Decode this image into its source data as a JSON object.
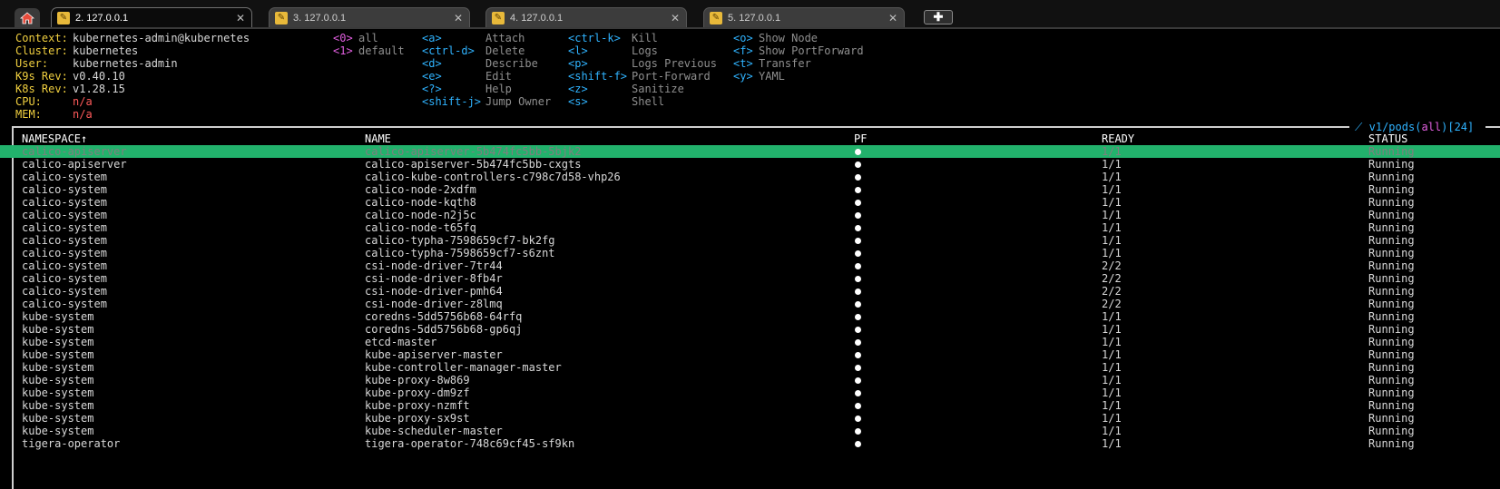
{
  "tabs": {
    "home_icon": "home-icon",
    "items": [
      {
        "label": "2. 127.0.0.1",
        "active": true
      },
      {
        "label": "3. 127.0.0.1",
        "active": false
      },
      {
        "label": "4. 127.0.0.1",
        "active": false
      },
      {
        "label": "5. 127.0.0.1",
        "active": false
      }
    ],
    "new_tab_symbol": "✚"
  },
  "info": {
    "context_label": "Context:",
    "context_value": "kubernetes-admin@kubernetes",
    "cluster_label": "Cluster:",
    "cluster_value": "kubernetes",
    "user_label": "User:",
    "user_value": "kubernetes-admin",
    "k9s_label": "K9s Rev:",
    "k9s_value": "v0.40.10",
    "k8s_label": "K8s Rev:",
    "k8s_value": "v1.28.15",
    "cpu_label": "CPU:",
    "cpu_value": "n/a",
    "mem_label": "MEM:",
    "mem_value": "n/a"
  },
  "namespaces": [
    {
      "key": "<0>",
      "label": "all"
    },
    {
      "key": "<1>",
      "label": "default"
    }
  ],
  "shortcuts": {
    "col1": [
      {
        "key": "<a>",
        "label": "Attach"
      },
      {
        "key": "<ctrl-d>",
        "label": "Delete"
      },
      {
        "key": "<d>",
        "label": "Describe"
      },
      {
        "key": "<e>",
        "label": "Edit"
      },
      {
        "key": "<?>",
        "label": "Help"
      },
      {
        "key": "<shift-j>",
        "label": "Jump Owner"
      }
    ],
    "col2": [
      {
        "key": "<ctrl-k>",
        "label": "Kill"
      },
      {
        "key": "<l>",
        "label": "Logs"
      },
      {
        "key": "<p>",
        "label": "Logs Previous"
      },
      {
        "key": "<shift-f>",
        "label": "Port-Forward"
      },
      {
        "key": "<z>",
        "label": "Sanitize"
      },
      {
        "key": "<s>",
        "label": "Shell"
      }
    ],
    "col3": [
      {
        "key": "<o>",
        "label": "Show Node"
      },
      {
        "key": "<f>",
        "label": "Show PortForward"
      },
      {
        "key": "<t>",
        "label": "Transfer"
      },
      {
        "key": "<y>",
        "label": "YAML"
      }
    ]
  },
  "view_title": {
    "prefix": " v1/pods(",
    "scope": "all",
    "suffix": ")[24] "
  },
  "table": {
    "headers": {
      "namespace": "NAMESPACE↑",
      "name": "NAME",
      "pf": "PF",
      "ready": "READY",
      "status": "STATUS"
    },
    "selected_index": 0,
    "rows": [
      {
        "namespace": "calico-apiserver",
        "name": "calico-apiserver-5b474fc5bb-5bjk2",
        "ready": "1/1",
        "status": "Running"
      },
      {
        "namespace": "calico-apiserver",
        "name": "calico-apiserver-5b474fc5bb-cxgts",
        "ready": "1/1",
        "status": "Running"
      },
      {
        "namespace": "calico-system",
        "name": "calico-kube-controllers-c798c7d58-vhp26",
        "ready": "1/1",
        "status": "Running"
      },
      {
        "namespace": "calico-system",
        "name": "calico-node-2xdfm",
        "ready": "1/1",
        "status": "Running"
      },
      {
        "namespace": "calico-system",
        "name": "calico-node-kqth8",
        "ready": "1/1",
        "status": "Running"
      },
      {
        "namespace": "calico-system",
        "name": "calico-node-n2j5c",
        "ready": "1/1",
        "status": "Running"
      },
      {
        "namespace": "calico-system",
        "name": "calico-node-t65fq",
        "ready": "1/1",
        "status": "Running"
      },
      {
        "namespace": "calico-system",
        "name": "calico-typha-7598659cf7-bk2fg",
        "ready": "1/1",
        "status": "Running"
      },
      {
        "namespace": "calico-system",
        "name": "calico-typha-7598659cf7-s6znt",
        "ready": "1/1",
        "status": "Running"
      },
      {
        "namespace": "calico-system",
        "name": "csi-node-driver-7tr44",
        "ready": "2/2",
        "status": "Running"
      },
      {
        "namespace": "calico-system",
        "name": "csi-node-driver-8fb4r",
        "ready": "2/2",
        "status": "Running"
      },
      {
        "namespace": "calico-system",
        "name": "csi-node-driver-pmh64",
        "ready": "2/2",
        "status": "Running"
      },
      {
        "namespace": "calico-system",
        "name": "csi-node-driver-z8lmq",
        "ready": "2/2",
        "status": "Running"
      },
      {
        "namespace": "kube-system",
        "name": "coredns-5dd5756b68-64rfq",
        "ready": "1/1",
        "status": "Running"
      },
      {
        "namespace": "kube-system",
        "name": "coredns-5dd5756b68-gp6qj",
        "ready": "1/1",
        "status": "Running"
      },
      {
        "namespace": "kube-system",
        "name": "etcd-master",
        "ready": "1/1",
        "status": "Running"
      },
      {
        "namespace": "kube-system",
        "name": "kube-apiserver-master",
        "ready": "1/1",
        "status": "Running"
      },
      {
        "namespace": "kube-system",
        "name": "kube-controller-manager-master",
        "ready": "1/1",
        "status": "Running"
      },
      {
        "namespace": "kube-system",
        "name": "kube-proxy-8w869",
        "ready": "1/1",
        "status": "Running"
      },
      {
        "namespace": "kube-system",
        "name": "kube-proxy-dm9zf",
        "ready": "1/1",
        "status": "Running"
      },
      {
        "namespace": "kube-system",
        "name": "kube-proxy-nzmft",
        "ready": "1/1",
        "status": "Running"
      },
      {
        "namespace": "kube-system",
        "name": "kube-proxy-sx9st",
        "ready": "1/1",
        "status": "Running"
      },
      {
        "namespace": "kube-system",
        "name": "kube-scheduler-master",
        "ready": "1/1",
        "status": "Running"
      },
      {
        "namespace": "tigera-operator",
        "name": "tigera-operator-748c69cf45-sf9kn",
        "ready": "1/1",
        "status": "Running"
      }
    ]
  },
  "colors": {
    "selected_row": "#22b26c",
    "label_yellow": "#f0cf3f",
    "key_blue": "#2fb3ff",
    "key_magenta": "#e25fe0",
    "metric_red": "#ff5a5a"
  }
}
